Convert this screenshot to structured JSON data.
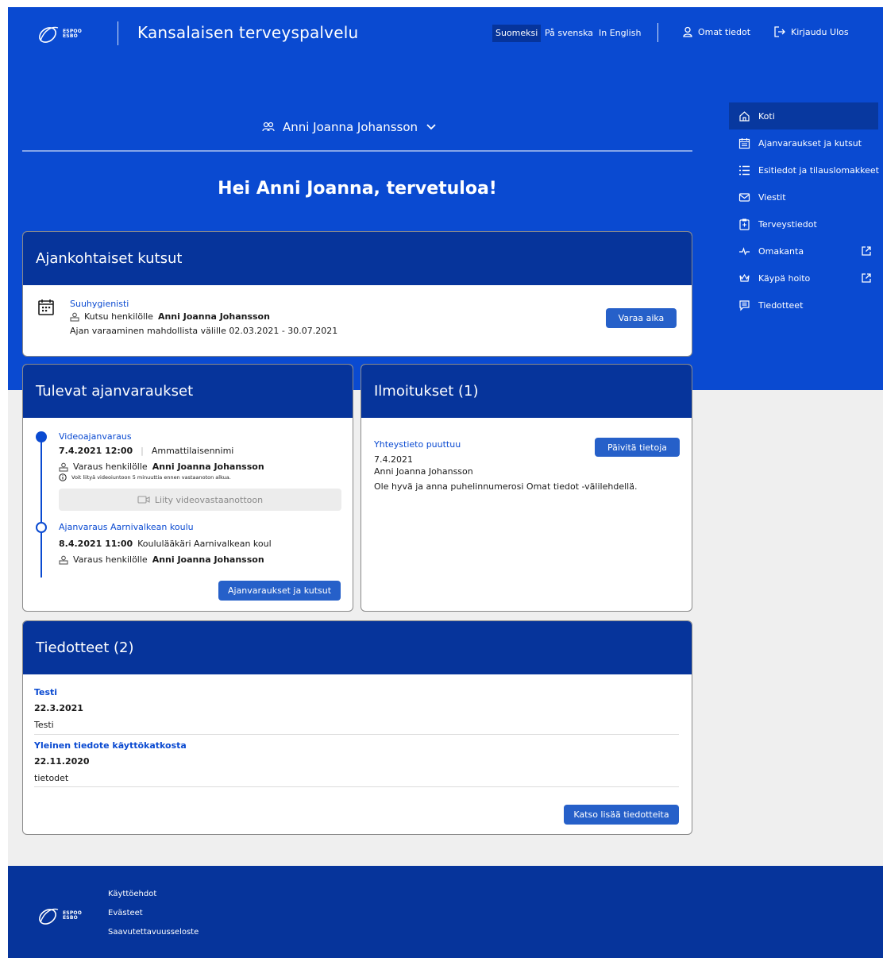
{
  "header": {
    "app_title": "Kansalaisen terveyspalvelu",
    "logo_text_line1": "ESPOO",
    "logo_text_line2": "ESBO",
    "languages": [
      "Suomeksi",
      "På svenska",
      "In English"
    ],
    "active_language": "Suomeksi",
    "profile_link": "Omat tiedot",
    "logout_link": "Kirjaudu Ulos"
  },
  "person_selector": {
    "name": "Anni Joanna Johansson"
  },
  "greeting": "Hei Anni Joanna, tervetuloa!",
  "sidebar": {
    "items": [
      {
        "label": "Koti",
        "icon": "home-icon",
        "active": true
      },
      {
        "label": "Ajanvaraukset ja kutsut",
        "icon": "calendar-icon"
      },
      {
        "label": "Esitiedot ja tilauslomakkeet",
        "icon": "list-icon"
      },
      {
        "label": "Viestit",
        "icon": "mail-icon"
      },
      {
        "label": "Terveystiedot",
        "icon": "clipboard-icon"
      },
      {
        "label": "Omakanta",
        "icon": "pulse-icon",
        "external": true
      },
      {
        "label": "Käypä hoito",
        "icon": "crown-icon",
        "external": true
      },
      {
        "label": "Tiedotteet",
        "icon": "notice-icon"
      }
    ]
  },
  "invitations": {
    "title": "Ajankohtaiset kutsut",
    "item": {
      "name": "Suuhygienisti",
      "for_prefix": "Kutsu henkilölle",
      "person": "Anni Joanna Johansson",
      "period": "Ajan varaaminen mahdollista välille 02.03.2021 - 30.07.2021",
      "button": "Varaa aika"
    }
  },
  "appointments": {
    "title": "Tulevat ajanvaraukset",
    "items": [
      {
        "name": "Videoajanvaraus",
        "datetime": "7.4.2021 12:00",
        "professional": "Ammattilaisennimi",
        "for_prefix": "Varaus henkilölle",
        "person": "Anni Joanna Johansson",
        "note": "Voit liityä videoiuntoon 5 minuuttia ennen vastaanoton alkua.",
        "video_button": "Liity videovastaanottoon"
      },
      {
        "name": "Ajanvaraus Aarnivalkean koulu",
        "datetime": "8.4.2021 11:00",
        "professional": "Koululääkäri Aarnivalkean koul",
        "for_prefix": "Varaus henkilölle",
        "person": "Anni Joanna Johansson"
      }
    ],
    "button": "Ajanvaraukset ja kutsut"
  },
  "notifications": {
    "title": "Ilmoitukset (1)",
    "item": {
      "name": "Yhteystieto puuttuu",
      "date": "7.4.2021",
      "person": "Anni Joanna Johansson",
      "message": "Ole hyvä ja anna puhelinnumerosi Omat tiedot -välilehdellä.",
      "button": "Päivitä tietoja"
    }
  },
  "bulletins": {
    "title": "Tiedotteet (2)",
    "items": [
      {
        "title": "Testi",
        "date": "22.3.2021",
        "body": "Testi"
      },
      {
        "title": "Yleinen tiedote käyttökatkosta",
        "date": "22.11.2020",
        "body": "tietodet"
      }
    ],
    "button": "Katso lisää tiedotteita"
  },
  "footer": {
    "links": [
      "Käyttöehdot",
      "Evästeet",
      "Saavutettavuusseloste"
    ]
  },
  "colors": {
    "brand_blue": "#0a4ad1",
    "dark_blue": "#06349b",
    "button_blue": "#2660c9",
    "background": "#efefef"
  }
}
